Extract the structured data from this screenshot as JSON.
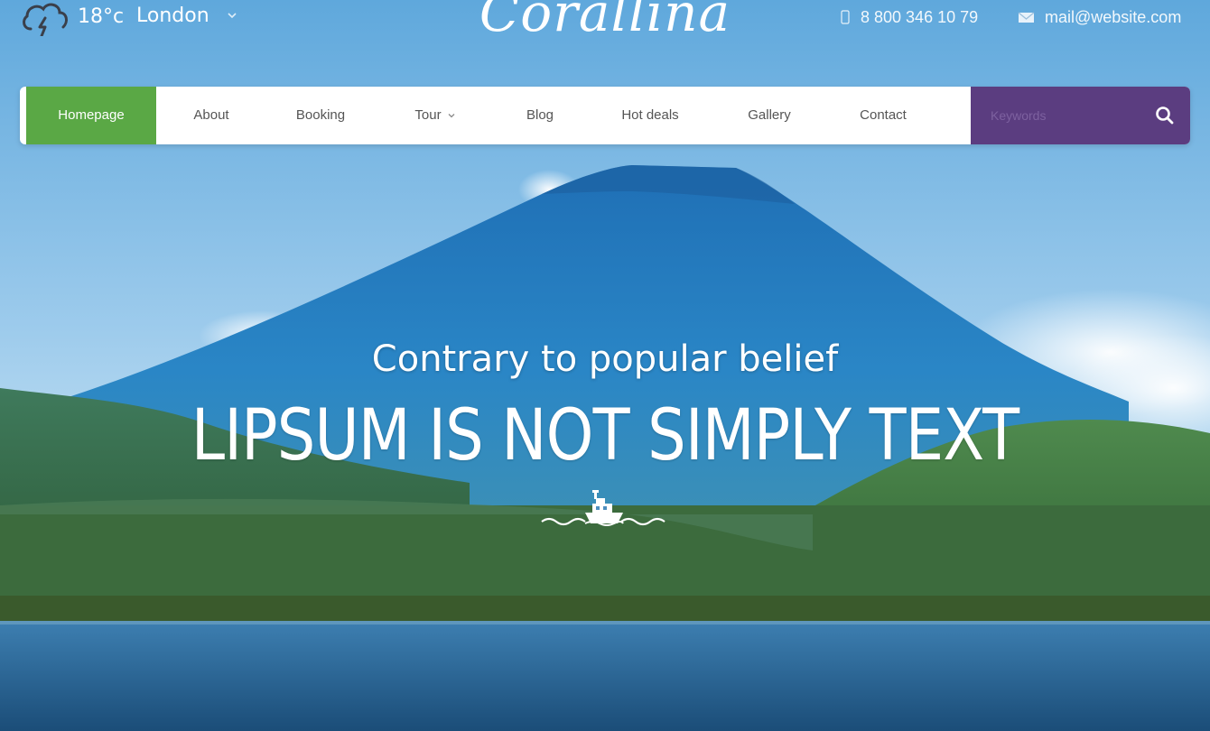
{
  "topbar": {
    "temperature": "18°c",
    "city": "London",
    "weather_icon": "cloud-lightning-icon",
    "logo": "Corallina",
    "phone": "8 800 346 10 79",
    "email": "mail@website.com"
  },
  "nav": {
    "items": [
      {
        "label": "Homepage",
        "active": true
      },
      {
        "label": "About"
      },
      {
        "label": "Booking"
      },
      {
        "label": "Tour",
        "has_dropdown": true
      },
      {
        "label": "Blog"
      },
      {
        "label": "Hot deals"
      },
      {
        "label": "Gallery"
      },
      {
        "label": "Contact"
      }
    ],
    "search_placeholder": "Keywords",
    "search_icon": "search-icon"
  },
  "hero": {
    "subtitle": "Contrary to popular belief",
    "title": "LIPSUM IS NOT SIMPLY TEXT",
    "decoration_icon": "boat-icon"
  },
  "colors": {
    "home_active": "#5aa845",
    "search_bg": "#5b3d80",
    "nav_bg": "#ffffff",
    "text_white": "#ffffff"
  }
}
